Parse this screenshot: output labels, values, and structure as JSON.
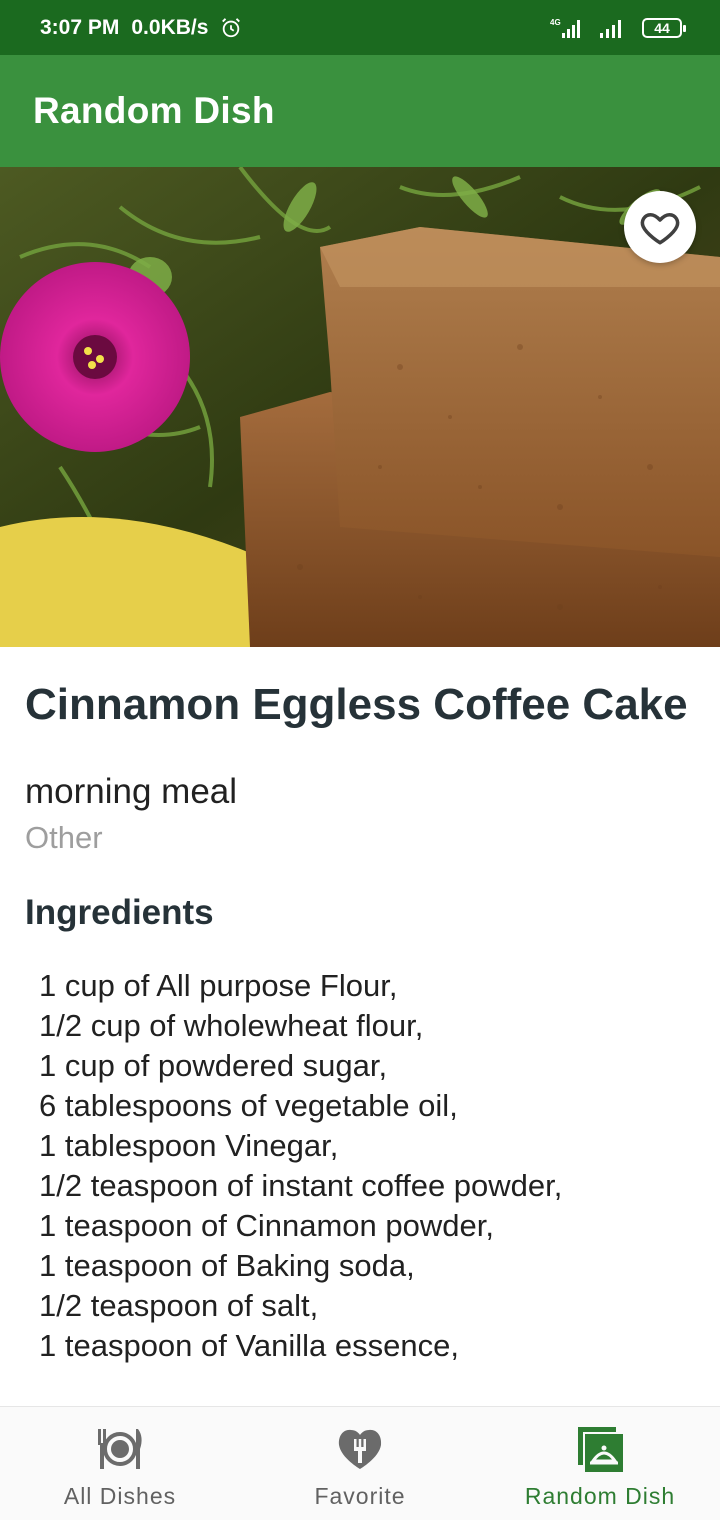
{
  "status_bar": {
    "time": "3:07 PM",
    "speed": "0.0KB/s",
    "network": "4G",
    "battery": "44"
  },
  "app_bar": {
    "title": "Random Dish"
  },
  "dish": {
    "image_icon": "dish-photo",
    "favorite_icon": "heart-outline-icon",
    "title": "Cinnamon Eggless Coffee Cake",
    "type": "morning meal",
    "category": "Other",
    "ingredients_heading": "Ingredients",
    "ingredients": [
      "1 cup of All purpose Flour,",
      "1/2 cup of wholewheat flour,",
      "1 cup of powdered sugar,",
      "6 tablespoons of vegetable oil,",
      "1 tablespoon Vinegar,",
      "1/2 teaspoon of instant coffee powder,",
      "1 teaspoon of Cinnamon powder,",
      "1 teaspoon of Baking soda,",
      "1/2 teaspoon of salt,",
      "1 teaspoon of Vanilla essence,"
    ]
  },
  "bottom_nav": {
    "items": [
      {
        "label": "All Dishes",
        "icon": "plate-cutlery-icon",
        "active": false
      },
      {
        "label": "Favorite",
        "icon": "heart-fork-icon",
        "active": false
      },
      {
        "label": "Random Dish",
        "icon": "random-dish-icon",
        "active": true
      }
    ]
  },
  "colors": {
    "status_bar": "#1b6a1f",
    "app_bar": "#3a913e",
    "active_nav": "#2e7d32",
    "inactive_nav": "#616161",
    "title_text": "#263238"
  }
}
